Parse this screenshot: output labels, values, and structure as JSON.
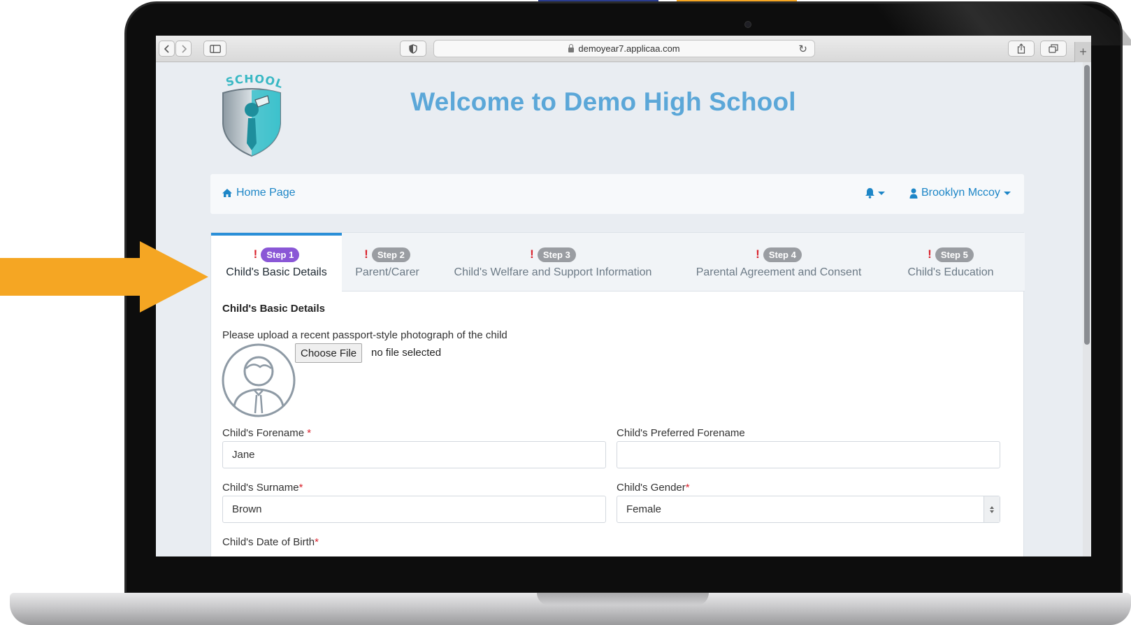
{
  "browser": {
    "url": "demoyear7.applicaa.com"
  },
  "logo": {
    "text": "SCHOOL"
  },
  "header": {
    "title": "Welcome to Demo High School"
  },
  "navbar": {
    "home_label": "Home Page",
    "user_name": "Brooklyn Mccoy"
  },
  "tabs": [
    {
      "badge": "Step 1",
      "label": "Child's Basic Details",
      "alert": "!"
    },
    {
      "badge": "Step 2",
      "label": "Parent/Carer",
      "alert": "!"
    },
    {
      "badge": "Step 3",
      "label": "Child's Welfare and Support Information",
      "alert": "!"
    },
    {
      "badge": "Step 4",
      "label": "Parental Agreement and Consent",
      "alert": "!"
    },
    {
      "badge": "Step 5",
      "label": "Child's Education",
      "alert": "!"
    }
  ],
  "form": {
    "section_title": "Child's Basic Details",
    "upload_prompt": "Please upload a recent passport-style photograph of the child",
    "choose_file": "Choose File",
    "no_file": "no file selected",
    "required_mark": "*",
    "forename": {
      "label": "Child's Forename ",
      "value": "Jane"
    },
    "preferred_forename": {
      "label": "Child's Preferred Forename",
      "value": ""
    },
    "surname": {
      "label": "Child's Surname",
      "value": "Brown"
    },
    "gender": {
      "label": "Child's Gender",
      "value": "Female"
    },
    "dob": {
      "label": "Child's Date of Birth"
    }
  },
  "colors": {
    "accent": "#2a8fd8",
    "active_badge": "#8a57d6",
    "title_blue": "#5ba7d8",
    "arrow": "#f5a623",
    "required": "#d9232d"
  }
}
